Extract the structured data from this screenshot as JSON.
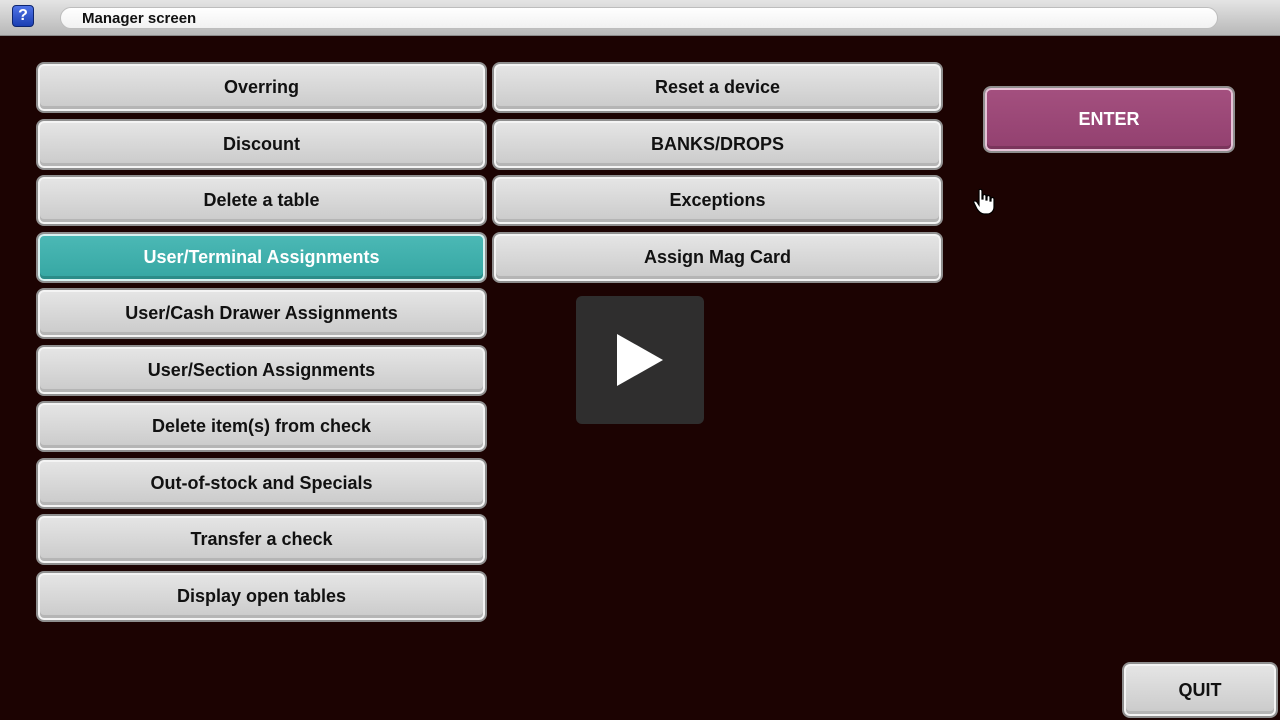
{
  "window": {
    "help_icon_text": "?",
    "title": "Manager screen"
  },
  "menu": {
    "left": [
      {
        "label": "Overring",
        "selected": false
      },
      {
        "label": "Discount",
        "selected": false
      },
      {
        "label": "Delete a table",
        "selected": false
      },
      {
        "label": "User/Terminal Assignments",
        "selected": true
      },
      {
        "label": "User/Cash Drawer Assignments",
        "selected": false
      },
      {
        "label": "User/Section Assignments",
        "selected": false
      },
      {
        "label": "Delete item(s) from check",
        "selected": false
      },
      {
        "label": "Out-of-stock and Specials",
        "selected": false
      },
      {
        "label": "Transfer a check",
        "selected": false
      },
      {
        "label": "Display open tables",
        "selected": false
      }
    ],
    "right": [
      {
        "label": "Reset a device"
      },
      {
        "label": "BANKS/DROPS"
      },
      {
        "label": "Exceptions"
      },
      {
        "label": "Assign Mag Card"
      }
    ]
  },
  "actions": {
    "enter_label": "ENTER",
    "quit_label": "QUIT"
  },
  "overlay": {
    "icon": "play-icon"
  },
  "colors": {
    "background": "#1c0302",
    "button": "#d5d5d5",
    "selected": "#40b0ad",
    "enter": "#9b4675"
  }
}
